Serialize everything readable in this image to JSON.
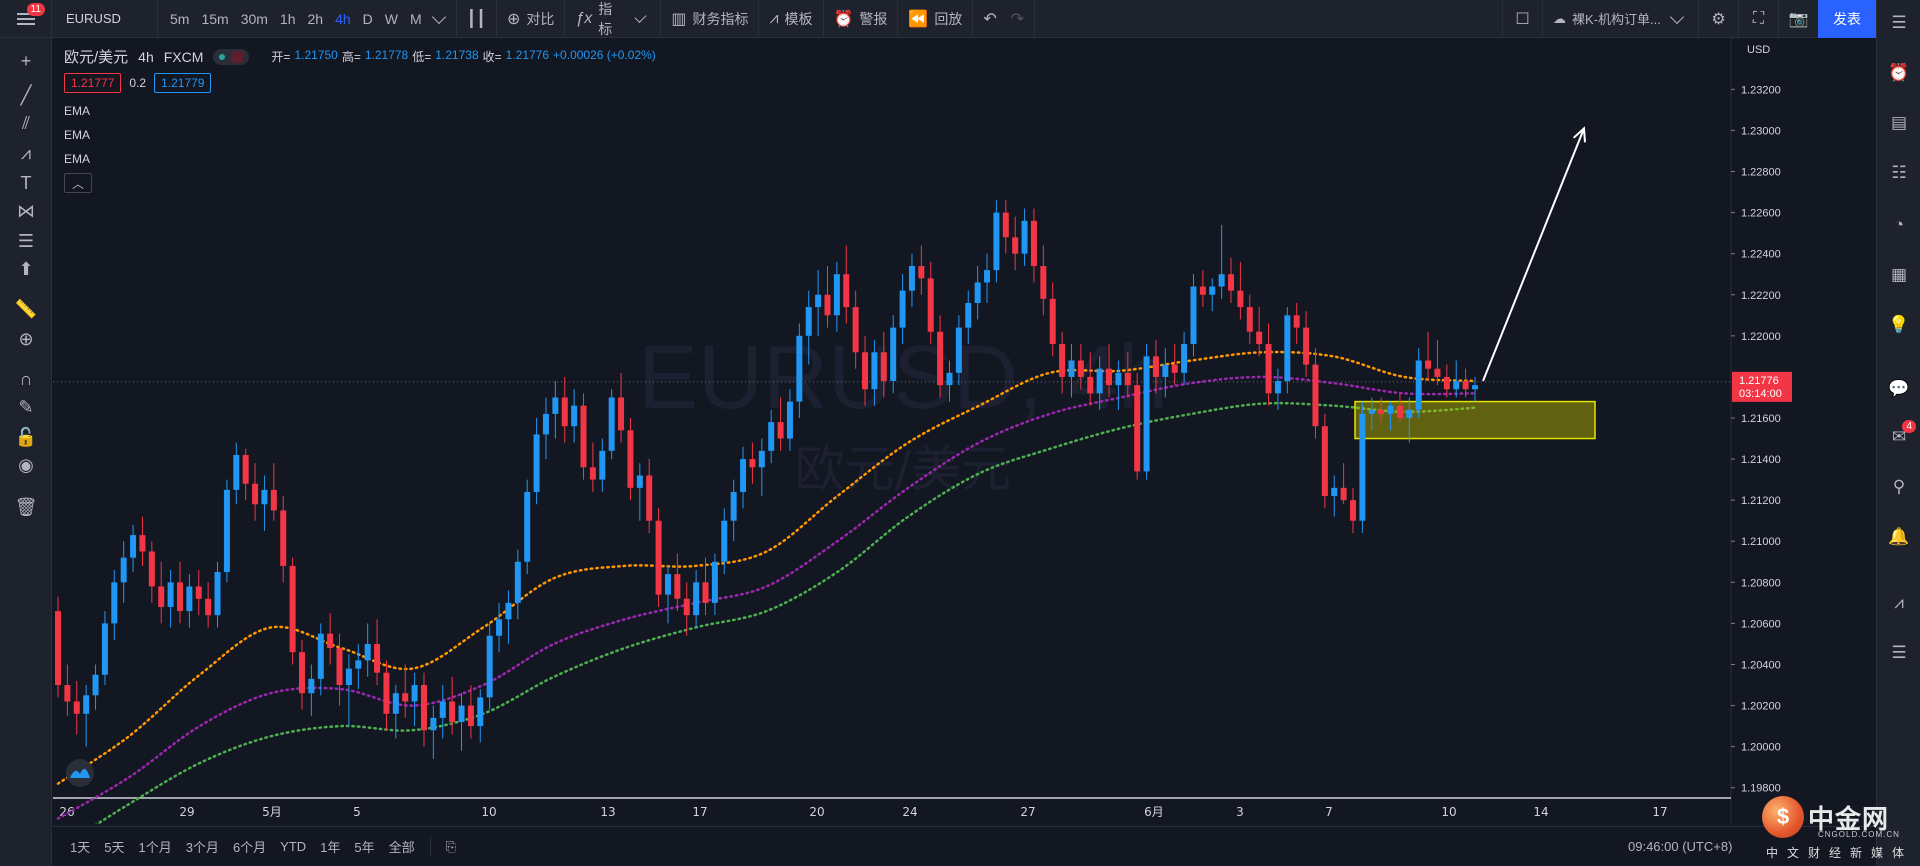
{
  "topbar": {
    "menu_badge": "11",
    "symbol": "EURUSD",
    "intervals": [
      "5m",
      "15m",
      "30m",
      "1h",
      "2h",
      "4h",
      "D",
      "W",
      "M"
    ],
    "active_interval": "4h",
    "compare_label": "对比",
    "indicators_label": "指标",
    "financials_label": "财务指标",
    "templates_label": "模板",
    "alert_label": "警报",
    "replay_label": "回放",
    "layout_name": "裸K-机构订单...",
    "publish_label": "发表"
  },
  "legend": {
    "pair": "欧元/美元",
    "interval": "4h",
    "source": "FXCM",
    "open_label": "开=",
    "open": "1.21750",
    "high_label": "高=",
    "high": "1.21778",
    "low_label": "低=",
    "low": "1.21738",
    "close_label": "收=",
    "close": "1.21776",
    "change": "+0.00026 (+0.02%)",
    "sell_price": "1.21777",
    "spread": "0.2",
    "buy_price": "1.21779",
    "indicators": [
      "EMA",
      "EMA",
      "EMA"
    ],
    "collapse_icon": "chevron-up-icon"
  },
  "watermark": {
    "symbol": "EURUSD, 4h",
    "name": "欧元/美元"
  },
  "price_axis": {
    "currency": "USD",
    "ticks": [
      "1.23200",
      "1.23000",
      "1.22800",
      "1.22600",
      "1.22400",
      "1.22200",
      "1.22000",
      "1.21600",
      "1.21400",
      "1.21200",
      "1.21000",
      "1.20800",
      "1.20600",
      "1.20400",
      "1.20200",
      "1.20000",
      "1.19800"
    ],
    "last_price": "1.21776",
    "countdown": "03:14:00"
  },
  "time_axis": {
    "ticks": [
      "26",
      "29",
      "5月",
      "5",
      "10",
      "13",
      "17",
      "20",
      "24",
      "27",
      "6月",
      "3",
      "7",
      "10",
      "14",
      "17"
    ]
  },
  "bottombar": {
    "ranges": [
      "1天",
      "5天",
      "1个月",
      "3个月",
      "6个月",
      "YTD",
      "1年",
      "5年",
      "全部"
    ],
    "clock": "09:46:00 (UTC+8)"
  },
  "branding": {
    "logo_text": "中金网",
    "logo_url": "CNGOLD.COM.CN",
    "tagline": "中文财经新媒体"
  },
  "colors": {
    "up": "#2196f3",
    "down": "#f23645",
    "ema_fast": "#ff9800",
    "ema_mid": "#9c27b0",
    "ema_slow": "#4caf50",
    "zone_fill": "rgba(191,191,0,0.45)",
    "zone_border": "#e5e500"
  },
  "chart_data": {
    "type": "candlestick",
    "symbol": "EURUSD",
    "interval": "4h",
    "ylim": [
      1.1975,
      1.2345
    ],
    "x_tick_labels": [
      "26",
      "29",
      "5月",
      "5",
      "10",
      "13",
      "17",
      "20",
      "24",
      "27",
      "6月",
      "3",
      "7",
      "10",
      "14",
      "17"
    ],
    "ema_fast": [
      1.1982,
      1.2005,
      1.2035,
      1.2058,
      1.2048,
      1.2038,
      1.2058,
      1.2082,
      1.2088,
      1.2088,
      1.2095,
      1.2122,
      1.2148,
      1.2166,
      1.2182,
      1.2183,
      1.2188,
      1.2192,
      1.219,
      1.218,
      1.2178
    ],
    "ema_mid": [
      1.1965,
      1.1985,
      1.201,
      1.2026,
      1.2028,
      1.202,
      1.203,
      1.205,
      1.2062,
      1.207,
      1.2078,
      1.21,
      1.2126,
      1.2148,
      1.2162,
      1.217,
      1.2177,
      1.218,
      1.2177,
      1.2172,
      1.2172
    ],
    "ema_slow": [
      1.195,
      1.1972,
      1.1992,
      1.2005,
      1.201,
      1.2008,
      1.2016,
      1.2034,
      1.2048,
      1.2058,
      1.2066,
      1.2085,
      1.2112,
      1.2133,
      1.2145,
      1.2155,
      1.2162,
      1.2167,
      1.2166,
      1.2163,
      1.2165
    ],
    "zone": {
      "low": 1.215,
      "high": 1.2168
    },
    "projection": {
      "from": 1.2178,
      "to": 1.2301
    },
    "candles": [
      [
        1.2066,
        1.2073,
        1.2024,
        1.203
      ],
      [
        1.203,
        1.204,
        1.2015,
        1.2022
      ],
      [
        1.2022,
        1.2032,
        1.2006,
        1.2016
      ],
      [
        1.2016,
        1.203,
        1.2,
        1.2025
      ],
      [
        1.2025,
        1.204,
        1.2018,
        1.2035
      ],
      [
        1.2035,
        1.2066,
        1.203,
        1.206
      ],
      [
        1.206,
        1.2086,
        1.2052,
        1.208
      ],
      [
        1.208,
        1.21,
        1.207,
        1.2092
      ],
      [
        1.2092,
        1.2108,
        1.2085,
        1.2103
      ],
      [
        1.2103,
        1.2112,
        1.2088,
        1.2095
      ],
      [
        1.2095,
        1.21,
        1.207,
        1.2078
      ],
      [
        1.2078,
        1.209,
        1.206,
        1.2068
      ],
      [
        1.2068,
        1.2086,
        1.2058,
        1.208
      ],
      [
        1.208,
        1.209,
        1.206,
        1.2066
      ],
      [
        1.2066,
        1.2084,
        1.2058,
        1.2078
      ],
      [
        1.2078,
        1.2086,
        1.2064,
        1.2072
      ],
      [
        1.2072,
        1.208,
        1.2058,
        1.2064
      ],
      [
        1.2064,
        1.209,
        1.2058,
        1.2085
      ],
      [
        1.2085,
        1.213,
        1.208,
        1.2125
      ],
      [
        1.2125,
        1.2148,
        1.2118,
        1.2142
      ],
      [
        1.2142,
        1.2145,
        1.212,
        1.2128
      ],
      [
        1.2128,
        1.2138,
        1.211,
        1.2118
      ],
      [
        1.2118,
        1.2132,
        1.2105,
        1.2125
      ],
      [
        1.2125,
        1.2138,
        1.211,
        1.2115
      ],
      [
        1.2115,
        1.2122,
        1.208,
        1.2088
      ],
      [
        1.2088,
        1.2092,
        1.204,
        1.2046
      ],
      [
        1.2046,
        1.2052,
        1.2018,
        1.2026
      ],
      [
        1.2026,
        1.204,
        1.2015,
        1.2033
      ],
      [
        1.2033,
        1.206,
        1.2025,
        1.2055
      ],
      [
        1.2055,
        1.2065,
        1.204,
        1.2048
      ],
      [
        1.2048,
        1.2055,
        1.202,
        1.203
      ],
      [
        1.203,
        1.2045,
        1.201,
        1.2038
      ],
      [
        1.2038,
        1.205,
        1.2028,
        1.2042
      ],
      [
        1.2042,
        1.206,
        1.2034,
        1.205
      ],
      [
        1.205,
        1.2062,
        1.203,
        1.2036
      ],
      [
        1.2036,
        1.2042,
        1.2008,
        1.2016
      ],
      [
        1.2016,
        1.203,
        1.2004,
        1.2026
      ],
      [
        1.2026,
        1.204,
        1.2014,
        1.2022
      ],
      [
        1.2022,
        1.2036,
        1.201,
        1.203
      ],
      [
        1.203,
        1.2036,
        1.2,
        1.2008
      ],
      [
        1.2008,
        1.202,
        1.1994,
        1.2014
      ],
      [
        1.2014,
        1.203,
        1.2004,
        1.2022
      ],
      [
        1.2022,
        1.2034,
        1.2006,
        1.2012
      ],
      [
        1.2012,
        1.2026,
        1.1998,
        1.202
      ],
      [
        1.202,
        1.203,
        1.2004,
        1.201
      ],
      [
        1.201,
        1.2028,
        1.2002,
        1.2024
      ],
      [
        1.2024,
        1.206,
        1.2018,
        1.2054
      ],
      [
        1.2054,
        1.207,
        1.2046,
        1.2062
      ],
      [
        1.2062,
        1.2076,
        1.205,
        1.207
      ],
      [
        1.207,
        1.2096,
        1.2062,
        1.209
      ],
      [
        1.209,
        1.213,
        1.2084,
        1.2124
      ],
      [
        1.2124,
        1.216,
        1.2118,
        1.2152
      ],
      [
        1.2152,
        1.217,
        1.214,
        1.2162
      ],
      [
        1.2162,
        1.2178,
        1.215,
        1.217
      ],
      [
        1.217,
        1.218,
        1.2148,
        1.2156
      ],
      [
        1.2156,
        1.2174,
        1.2148,
        1.2166
      ],
      [
        1.2166,
        1.2172,
        1.213,
        1.2136
      ],
      [
        1.2136,
        1.2148,
        1.2124,
        1.213
      ],
      [
        1.213,
        1.215,
        1.2124,
        1.2144
      ],
      [
        1.2144,
        1.2174,
        1.214,
        1.217
      ],
      [
        1.217,
        1.2182,
        1.2148,
        1.2154
      ],
      [
        1.2154,
        1.216,
        1.212,
        1.2126
      ],
      [
        1.2126,
        1.2138,
        1.211,
        1.2132
      ],
      [
        1.2132,
        1.214,
        1.2104,
        1.211
      ],
      [
        1.211,
        1.2116,
        1.2068,
        1.2074
      ],
      [
        1.2074,
        1.2088,
        1.206,
        1.2084
      ],
      [
        1.2084,
        1.2094,
        1.2066,
        1.2072
      ],
      [
        1.2072,
        1.208,
        1.2054,
        1.2064
      ],
      [
        1.2064,
        1.2086,
        1.2058,
        1.208
      ],
      [
        1.208,
        1.2092,
        1.2064,
        1.207
      ],
      [
        1.207,
        1.2094,
        1.2064,
        1.209
      ],
      [
        1.209,
        1.2116,
        1.2084,
        1.211
      ],
      [
        1.211,
        1.213,
        1.21,
        1.2124
      ],
      [
        1.2124,
        1.2146,
        1.2116,
        1.214
      ],
      [
        1.214,
        1.2148,
        1.2128,
        1.2136
      ],
      [
        1.2136,
        1.215,
        1.2122,
        1.2144
      ],
      [
        1.2144,
        1.2164,
        1.2138,
        1.2158
      ],
      [
        1.2158,
        1.217,
        1.2144,
        1.215
      ],
      [
        1.215,
        1.2174,
        1.2144,
        1.2168
      ],
      [
        1.2168,
        1.2206,
        1.216,
        1.22
      ],
      [
        1.22,
        1.2222,
        1.2186,
        1.2214
      ],
      [
        1.2214,
        1.2232,
        1.22,
        1.222
      ],
      [
        1.222,
        1.2234,
        1.2204,
        1.221
      ],
      [
        1.221,
        1.2236,
        1.2202,
        1.223
      ],
      [
        1.223,
        1.2244,
        1.2206,
        1.2214
      ],
      [
        1.2214,
        1.2222,
        1.2184,
        1.2192
      ],
      [
        1.2192,
        1.22,
        1.2166,
        1.2174
      ],
      [
        1.2174,
        1.2198,
        1.2166,
        1.2192
      ],
      [
        1.2192,
        1.2202,
        1.217,
        1.2178
      ],
      [
        1.2178,
        1.221,
        1.2172,
        1.2204
      ],
      [
        1.2204,
        1.223,
        1.2196,
        1.2222
      ],
      [
        1.2222,
        1.224,
        1.2214,
        1.2234
      ],
      [
        1.2234,
        1.2244,
        1.222,
        1.2228
      ],
      [
        1.2228,
        1.2236,
        1.2196,
        1.2202
      ],
      [
        1.2202,
        1.221,
        1.217,
        1.2176
      ],
      [
        1.2176,
        1.2188,
        1.2168,
        1.2182
      ],
      [
        1.2182,
        1.221,
        1.2176,
        1.2204
      ],
      [
        1.2204,
        1.2222,
        1.2196,
        1.2216
      ],
      [
        1.2216,
        1.2234,
        1.2208,
        1.2226
      ],
      [
        1.2226,
        1.224,
        1.2216,
        1.2232
      ],
      [
        1.2232,
        1.2266,
        1.2226,
        1.226
      ],
      [
        1.226,
        1.2266,
        1.224,
        1.2248
      ],
      [
        1.2248,
        1.2258,
        1.2232,
        1.224
      ],
      [
        1.224,
        1.2262,
        1.2234,
        1.2256
      ],
      [
        1.2256,
        1.2262,
        1.2226,
        1.2234
      ],
      [
        1.2234,
        1.2244,
        1.221,
        1.2218
      ],
      [
        1.2218,
        1.2226,
        1.219,
        1.2196
      ],
      [
        1.2196,
        1.2202,
        1.2172,
        1.218
      ],
      [
        1.218,
        1.2196,
        1.217,
        1.2188
      ],
      [
        1.2188,
        1.2196,
        1.2174,
        1.218
      ],
      [
        1.218,
        1.2192,
        1.2166,
        1.2172
      ],
      [
        1.2172,
        1.219,
        1.2164,
        1.2184
      ],
      [
        1.2184,
        1.2196,
        1.217,
        1.2176
      ],
      [
        1.2176,
        1.2188,
        1.2164,
        1.2182
      ],
      [
        1.2182,
        1.2192,
        1.217,
        1.2176
      ],
      [
        1.2176,
        1.2182,
        1.213,
        1.2134
      ],
      [
        1.2134,
        1.2196,
        1.213,
        1.219
      ],
      [
        1.219,
        1.2198,
        1.2172,
        1.218
      ],
      [
        1.218,
        1.2194,
        1.217,
        1.2186
      ],
      [
        1.2186,
        1.2196,
        1.2176,
        1.2182
      ],
      [
        1.2182,
        1.2202,
        1.2176,
        1.2196
      ],
      [
        1.2196,
        1.223,
        1.219,
        1.2224
      ],
      [
        1.2224,
        1.2232,
        1.2214,
        1.222
      ],
      [
        1.222,
        1.2228,
        1.2212,
        1.2224
      ],
      [
        1.2224,
        1.2254,
        1.2218,
        1.223
      ],
      [
        1.223,
        1.2238,
        1.2216,
        1.2222
      ],
      [
        1.2222,
        1.2236,
        1.2208,
        1.2214
      ],
      [
        1.2214,
        1.222,
        1.2196,
        1.2202
      ],
      [
        1.2202,
        1.2214,
        1.219,
        1.2196
      ],
      [
        1.2196,
        1.2206,
        1.2166,
        1.2172
      ],
      [
        1.2172,
        1.2184,
        1.2164,
        1.2178
      ],
      [
        1.2178,
        1.2214,
        1.2172,
        1.221
      ],
      [
        1.221,
        1.2216,
        1.2196,
        1.2204
      ],
      [
        1.2204,
        1.2212,
        1.218,
        1.2186
      ],
      [
        1.2186,
        1.2194,
        1.215,
        1.2156
      ],
      [
        1.2156,
        1.2162,
        1.2116,
        1.2122
      ],
      [
        1.2122,
        1.2132,
        1.2112,
        1.2126
      ],
      [
        1.2126,
        1.2138,
        1.2118,
        1.212
      ],
      [
        1.212,
        1.2126,
        1.2104,
        1.211
      ],
      [
        1.211,
        1.2168,
        1.2104,
        1.2162
      ],
      [
        1.2162,
        1.217,
        1.2154,
        1.2164
      ],
      [
        1.2164,
        1.217,
        1.2158,
        1.2162
      ],
      [
        1.2162,
        1.2168,
        1.2154,
        1.2166
      ],
      [
        1.2166,
        1.2172,
        1.2158,
        1.216
      ],
      [
        1.216,
        1.217,
        1.2148,
        1.2164
      ],
      [
        1.2164,
        1.2194,
        1.216,
        1.2188
      ],
      [
        1.2188,
        1.2202,
        1.2178,
        1.2184
      ],
      [
        1.2184,
        1.2198,
        1.2176,
        1.218
      ],
      [
        1.218,
        1.2186,
        1.217,
        1.2174
      ],
      [
        1.2174,
        1.2188,
        1.217,
        1.2178
      ],
      [
        1.2178,
        1.2184,
        1.217,
        1.2174
      ],
      [
        1.2174,
        1.218,
        1.2168,
        1.2176
      ]
    ]
  }
}
